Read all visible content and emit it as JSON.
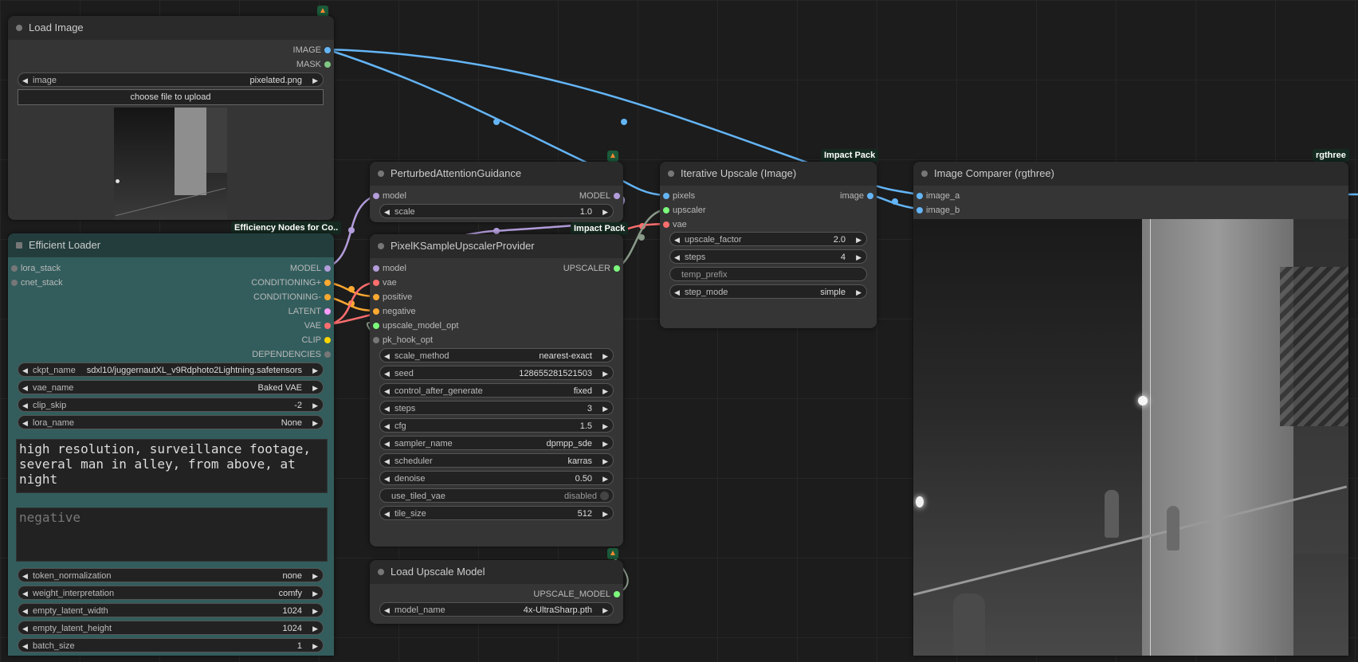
{
  "colors": {
    "image": "#64b5f6",
    "mask": "#81c784",
    "model": "#b39ddb",
    "conditioning": "#ffa931",
    "latent": "#ff9cf9",
    "vae": "#ff6e6e",
    "clip": "#ffd500",
    "dependencies": "#777777",
    "upscaler": "#7cfc7c",
    "badge_bg": "#1b5a3a"
  },
  "load_image": {
    "title": "Load Image",
    "outputs": [
      "IMAGE",
      "MASK"
    ],
    "image_label": "image",
    "image_value": "pixelated.png",
    "upload_button": "choose file to upload",
    "badge_icon": "fox-icon"
  },
  "efficient_loader": {
    "title": "Efficient Loader",
    "badge": "Efficiency Nodes for Co..",
    "inputs": [
      "lora_stack",
      "cnet_stack"
    ],
    "outputs": [
      "MODEL",
      "CONDITIONING+",
      "CONDITIONING-",
      "LATENT",
      "VAE",
      "CLIP",
      "DEPENDENCIES"
    ],
    "widgets": [
      {
        "label": "ckpt_name",
        "value": "sdxl10/juggernautXL_v9Rdphoto2Lightning.safetensors"
      },
      {
        "label": "vae_name",
        "value": "Baked VAE"
      },
      {
        "label": "clip_skip",
        "value": "-2"
      },
      {
        "label": "lora_name",
        "value": "None"
      }
    ],
    "positive_prompt": "high resolution, surveillance footage, several man in alley, from above, at night",
    "negative_placeholder": "negative",
    "widgets2": [
      {
        "label": "token_normalization",
        "value": "none"
      },
      {
        "label": "weight_interpretation",
        "value": "comfy"
      },
      {
        "label": "empty_latent_width",
        "value": "1024"
      },
      {
        "label": "empty_latent_height",
        "value": "1024"
      },
      {
        "label": "batch_size",
        "value": "1"
      }
    ]
  },
  "pag": {
    "title": "PerturbedAttentionGuidance",
    "input": "model",
    "output": "MODEL",
    "scale_label": "scale",
    "scale_value": "1.0"
  },
  "pixel_ksampler": {
    "title": "PixelKSampleUpscalerProvider",
    "badge": "Impact Pack",
    "inputs": [
      "model",
      "vae",
      "positive",
      "negative",
      "upscale_model_opt",
      "pk_hook_opt"
    ],
    "output": "UPSCALER",
    "widgets": [
      {
        "label": "scale_method",
        "value": "nearest-exact"
      },
      {
        "label": "seed",
        "value": "128655281521503"
      },
      {
        "label": "control_after_generate",
        "value": "fixed"
      },
      {
        "label": "steps",
        "value": "3"
      },
      {
        "label": "cfg",
        "value": "1.5"
      },
      {
        "label": "sampler_name",
        "value": "dpmpp_sde"
      },
      {
        "label": "scheduler",
        "value": "karras"
      },
      {
        "label": "denoise",
        "value": "0.50"
      }
    ],
    "toggle": {
      "label": "use_tiled_vae",
      "value": "disabled"
    },
    "tile_size": {
      "label": "tile_size",
      "value": "512"
    }
  },
  "load_upscale": {
    "title": "Load Upscale Model",
    "output": "UPSCALE_MODEL",
    "widget_label": "model_name",
    "widget_value": "4x-UltraSharp.pth"
  },
  "iterative_upscale": {
    "title": "Iterative Upscale (Image)",
    "badge": "Impact Pack",
    "inputs": [
      "pixels",
      "upscaler",
      "vae"
    ],
    "output": "image",
    "widgets": [
      {
        "label": "upscale_factor",
        "value": "2.0"
      },
      {
        "label": "steps",
        "value": "4"
      }
    ],
    "text_widget": "temp_prefix",
    "step_mode": {
      "label": "step_mode",
      "value": "simple"
    }
  },
  "image_comparer": {
    "title": "Image Comparer (rgthree)",
    "badge": "rgthree",
    "inputs": [
      "image_a",
      "image_b"
    ]
  }
}
